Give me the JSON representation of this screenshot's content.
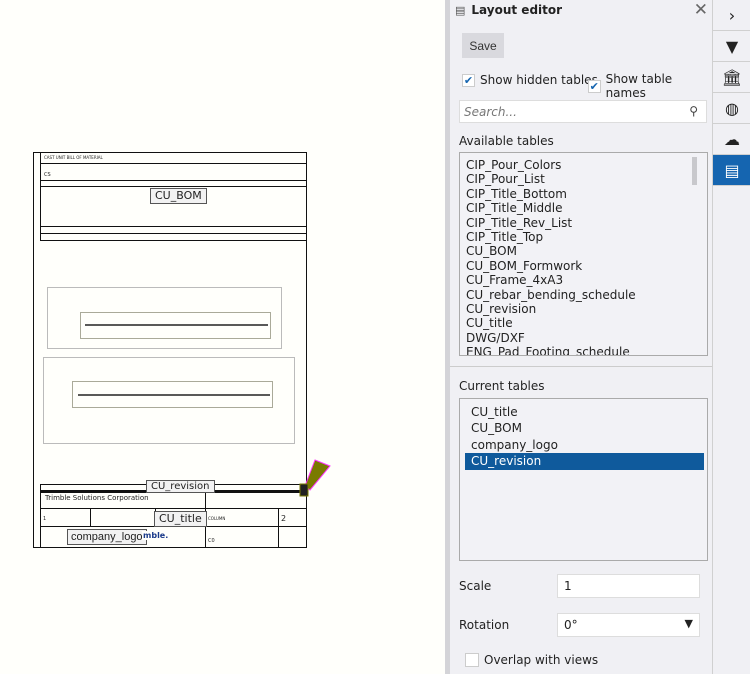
{
  "drawing": {
    "title_row": "CAST UNIT BILL OF MATERIAL",
    "cs": "CS",
    "company": "Trimble Solutions Corporation",
    "cell_1": "1",
    "cell_column": "COLUMN",
    "cell_2": "2",
    "cell_c0": "C0",
    "tags": {
      "bom": "CU_BOM",
      "revision": "CU_revision",
      "title": "CU_title",
      "logo": "company_logo",
      "logo_partial": "mble."
    }
  },
  "panel": {
    "title": "Layout editor",
    "save": "Save",
    "show_hidden": "Show hidden tables",
    "show_names": "Show table names",
    "search_placeholder": "Search...",
    "available_label": "Available tables",
    "available": [
      "CIP_Pour_Colors",
      "CIP_Pour_List",
      "CIP_Title_Bottom",
      "CIP_Title_Middle",
      "CIP_Title_Rev_List",
      "CIP_Title_Top",
      "CU_BOM",
      "CU_BOM_Formwork",
      "CU_Frame_4xA3",
      "CU_rebar_bending_schedule",
      "CU_revision",
      "CU_title",
      "DWG/DXF",
      "ENG_Pad_Footing_schedule"
    ],
    "current_label": "Current tables",
    "current": [
      "CU_title",
      "CU_BOM",
      "company_logo",
      "CU_revision"
    ],
    "current_selected": "CU_revision",
    "scale_label": "Scale",
    "scale": "1",
    "rotation_label": "Rotation",
    "rotation": "0°",
    "overlap": "Overlap with views"
  },
  "rail": [
    "chevron-right-icon",
    "filter-icon",
    "bank-icon",
    "globe-icon",
    "cloud-icon",
    "layout-icon"
  ],
  "colors": {
    "accent": "#1565b0",
    "selected": "#0f5a9c"
  }
}
